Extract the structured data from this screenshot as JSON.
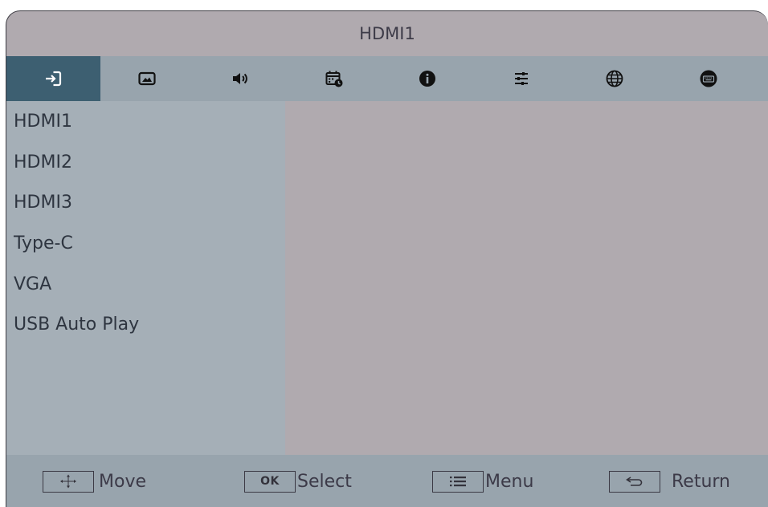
{
  "title": "HDMI1",
  "tabs": [
    {
      "icon": "input-source-icon",
      "active": true
    },
    {
      "icon": "picture-icon",
      "active": false
    },
    {
      "icon": "speaker-icon",
      "active": false
    },
    {
      "icon": "schedule-icon",
      "active": false
    },
    {
      "icon": "info-icon",
      "active": false
    },
    {
      "icon": "adjust-settings-icon",
      "active": false
    },
    {
      "icon": "globe-icon",
      "active": false
    },
    {
      "icon": "keyboard-icon",
      "active": false
    }
  ],
  "sources": [
    "HDMI1",
    "HDMI2",
    "HDMI3",
    "Type-C",
    "VGA",
    "USB Auto Play"
  ],
  "footer": {
    "move_label": "Move",
    "ok_key": "OK",
    "select_label": "Select",
    "menu_label": "Menu",
    "return_label": "Return"
  },
  "colors": {
    "active_tab": "#3d5f71",
    "tab_bar": "#98a4ad",
    "list_bg": "#a5afb7",
    "content_bg": "#b0aaaf"
  }
}
